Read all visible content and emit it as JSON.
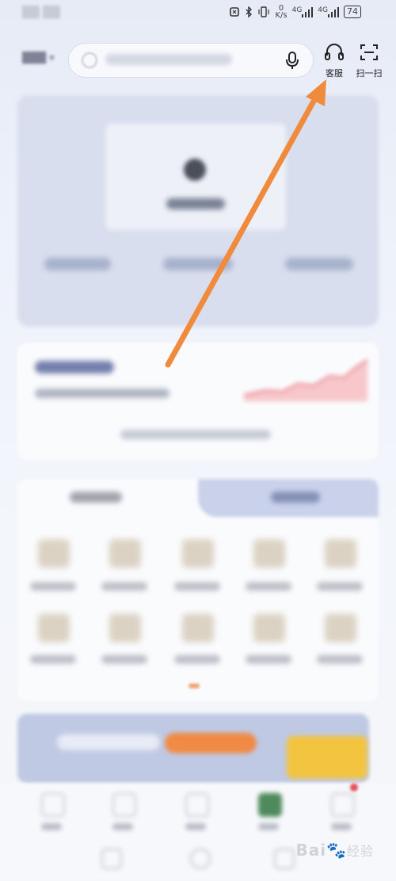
{
  "status_bar": {
    "net_speed_value": "0",
    "net_speed_unit": "K/s",
    "network_a": "4G",
    "network_b": "4G",
    "battery": "74"
  },
  "header": {
    "customer_service_label": "客服",
    "scan_label": "扫一扫"
  },
  "watermark": {
    "brand": "Bai",
    "suffix": "经验"
  },
  "colors": {
    "arrow": "#f08a3c",
    "accent_orange": "#f08a45",
    "promo_yellow": "#f2c440"
  },
  "icons": {
    "mic": "mic-icon",
    "headset": "headset-icon",
    "scan": "scan-icon"
  }
}
